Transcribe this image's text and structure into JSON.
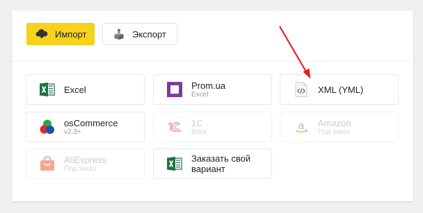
{
  "toolbar": {
    "import_label": "Импорт",
    "export_label": "Экспорт",
    "import_icon": "cloud-download-icon",
    "export_icon": "box-upload-icon",
    "accent_color": "#f7d21a"
  },
  "cards": [
    {
      "title": "Excel",
      "subtitle": "",
      "icon": "excel-icon",
      "disabled": false
    },
    {
      "title": "Prom.ua",
      "subtitle": "Excel",
      "icon": "prom-ua-icon",
      "disabled": false
    },
    {
      "title": "XML (YML)",
      "subtitle": "",
      "icon": "xml-file-icon",
      "disabled": false
    },
    {
      "title": "osCommerce",
      "subtitle": "v2.3+",
      "icon": "oscommerce-icon",
      "disabled": false
    },
    {
      "title": "1С",
      "subtitle": "Bitrix",
      "icon": "1c-icon",
      "disabled": true
    },
    {
      "title": "Amazon",
      "subtitle": "Под заказ",
      "icon": "amazon-icon",
      "disabled": true
    },
    {
      "title": "AliExpress",
      "subtitle": "Под заказ",
      "icon": "aliexpress-icon",
      "disabled": true
    },
    {
      "title": "Заказать свой вариант",
      "subtitle": "",
      "icon": "excel-icon",
      "disabled": false
    }
  ],
  "annotation": {
    "arrow_color": "#e31e24",
    "arrow_icon": "red-arrow-pointer"
  }
}
